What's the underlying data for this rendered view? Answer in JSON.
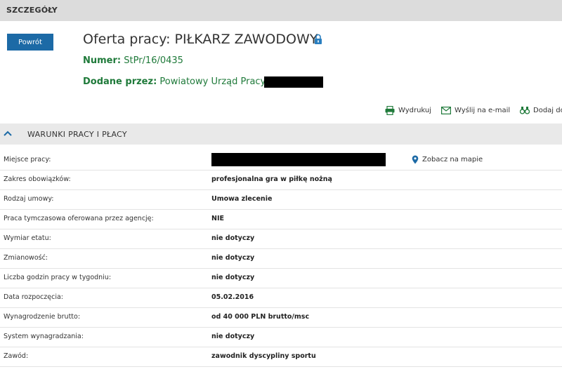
{
  "header": {
    "title": "SZCZEGÓŁY"
  },
  "offer": {
    "back_label": "Powrót",
    "title": "Oferta pracy: PIŁKARZ ZAWODOWY",
    "number_label": "Numer:",
    "number_value": "StPr/16/0435",
    "added_label": "Dodane przez:",
    "added_value": "Powiatowy Urząd Pracy"
  },
  "actions": {
    "print": "Wydrukuj",
    "email": "Wyślij na e-mail",
    "add": "Dodaj do"
  },
  "section": {
    "title": "WARUNKI PRACY I PŁACY",
    "map_link": "Zobacz na mapie",
    "rows": [
      {
        "label": "Miejsce pracy:",
        "value": ""
      },
      {
        "label": "Zakres obowiązków:",
        "value": "profesjonalna gra w piłkę nożną"
      },
      {
        "label": "Rodzaj umowy:",
        "value": "Umowa zlecenie"
      },
      {
        "label": "Praca tymczasowa oferowana przez agencję:",
        "value": "NIE"
      },
      {
        "label": "Wymiar etatu:",
        "value": "nie dotyczy"
      },
      {
        "label": "Zmianowość:",
        "value": "nie dotyczy"
      },
      {
        "label": "Liczba godzin pracy w tygodniu:",
        "value": "nie dotyczy"
      },
      {
        "label": "Data rozpoczęcia:",
        "value": "05.02.2016"
      },
      {
        "label": "Wynagrodzenie brutto:",
        "value": "od 40 000 PLN brutto/msc"
      },
      {
        "label": "System wynagradzania:",
        "value": "nie dotyczy"
      },
      {
        "label": "Zawód:",
        "value": "zawodnik dyscypliny sportu"
      }
    ]
  },
  "colors": {
    "accent_blue": "#1c6aa6",
    "meta_green": "#1f7a3a",
    "header_gray": "#dcdcdc"
  }
}
